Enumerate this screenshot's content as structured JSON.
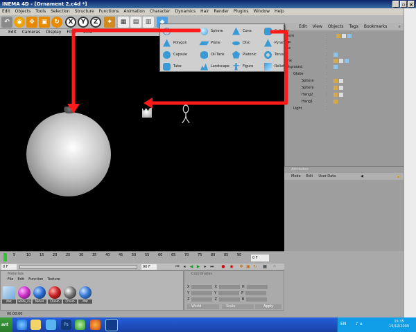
{
  "window": {
    "title": "INEMA 4D - [Ornament 2.c4d *]",
    "buttons": [
      "_",
      "▫",
      "×"
    ]
  },
  "menubar": [
    "Edit",
    "Objects",
    "Tools",
    "Selection",
    "Structure",
    "Functions",
    "Animation",
    "Character",
    "Dynamics",
    "Hair",
    "Render",
    "Plugins",
    "Window",
    "Help"
  ],
  "toolbar": {
    "axis_buttons": [
      "X",
      "Y",
      "Z"
    ]
  },
  "viewport": {
    "menu": [
      "Edit",
      "Cameras",
      "Display",
      "Filter",
      "View"
    ]
  },
  "primitive_menu": {
    "items": [
      [
        "",
        "Sphere",
        "Cone",
        "Cylinder"
      ],
      [
        "Polygon",
        "Plane",
        "Disc",
        "Pyramid"
      ],
      [
        "Capsule",
        "Oil Tank",
        "Platonic",
        "Torus"
      ],
      [
        "Tube",
        "Landscape",
        "Figure",
        "Relief"
      ]
    ]
  },
  "objects_panel": {
    "menu": [
      "Edit",
      "View",
      "Objects",
      "Tags",
      "Bookmarks"
    ],
    "rows": [
      "here",
      "be",
      "be",
      "y",
      "me",
      "ckground",
      "Globe",
      "Sphere",
      "Sphere",
      "Hang2",
      "Hang1",
      "Light"
    ]
  },
  "attributes_panel": {
    "title": "Attributes",
    "menu": [
      "Mode",
      "Edit",
      "User Data"
    ]
  },
  "timeline": {
    "ticks": [
      "5",
      "10",
      "15",
      "20",
      "25",
      "30",
      "35",
      "40",
      "45",
      "50",
      "55",
      "60",
      "65",
      "70",
      "75",
      "80",
      "85",
      "90"
    ],
    "current_frame": "0 F",
    "start_frame": "0 F",
    "end_frame": "90 F"
  },
  "materials": {
    "title": "Materials",
    "menu": [
      "File",
      "Edit",
      "Function",
      "Texture"
    ],
    "items": [
      {
        "label": "Mat",
        "color": "#6fa8dc"
      },
      {
        "label": "white_ca",
        "color": "#cc33cc"
      },
      {
        "label": "Nickel",
        "color": "#2a6fd6"
      },
      {
        "label": "Chrom",
        "color": "#cc2222"
      },
      {
        "label": "Chrom",
        "color": "#7a7a7a"
      },
      {
        "label": "Mat",
        "color": "#3a7ad6"
      }
    ]
  },
  "coordinates": {
    "title": "Coordinates",
    "rows": [
      [
        "X",
        "X",
        "H"
      ],
      [
        "Y",
        "Y",
        "P"
      ],
      [
        "Z",
        "Z",
        "B"
      ]
    ],
    "dropdown1": "World",
    "dropdown2": "Scale",
    "apply": "Apply"
  },
  "status": {
    "time": "00:00:00"
  },
  "taskbar": {
    "start": "art",
    "lang": "EN",
    "time": "15:35",
    "date": "15/12/2009"
  },
  "colors": {
    "arrow": "#ff1a1a",
    "viewport": "#000000",
    "taskbar": "#245edb"
  }
}
